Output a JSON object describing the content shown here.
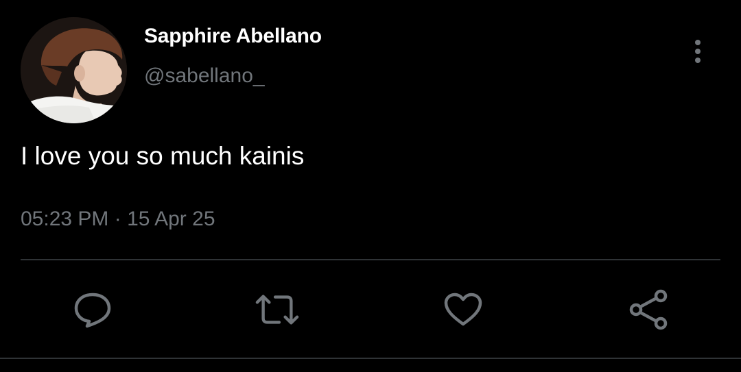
{
  "tweet": {
    "author": {
      "display_name": "Sapphire Abellano",
      "handle": "@sabellano_"
    },
    "text": "I love you so much kainis",
    "timestamp": "05:23 PM · 15 Apr 25"
  },
  "actions": {
    "reply_icon": "speech-bubble-icon",
    "retweet_icon": "retweet-arrows-icon",
    "like_icon": "heart-icon",
    "share_icon": "share-nodes-icon",
    "more_icon": "vertical-ellipsis-icon"
  },
  "colors": {
    "background": "#000000",
    "primary_text": "#ffffff",
    "secondary_text": "#71767b",
    "divider": "#2f3336",
    "icon": "#71767b"
  }
}
